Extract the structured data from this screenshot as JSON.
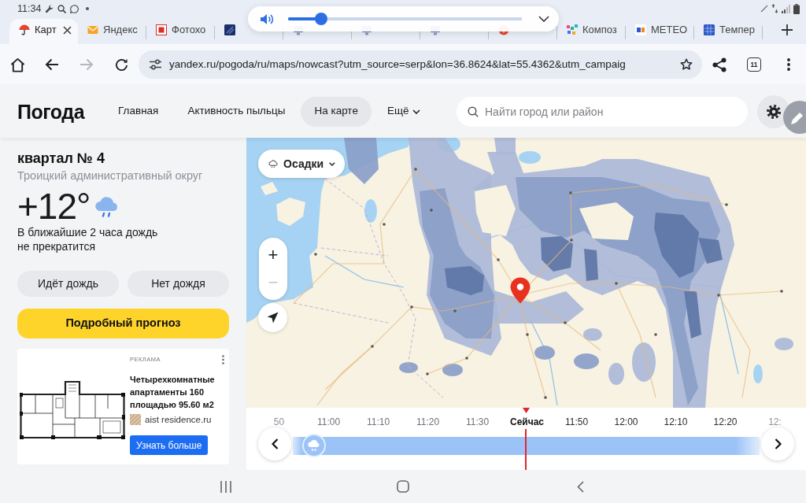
{
  "status_bar": {
    "time": "11:34"
  },
  "volume": {
    "level": 0.14
  },
  "tabs": [
    {
      "title": "Карт",
      "selected": true
    },
    {
      "title": "Яндекс",
      "selected": false
    },
    {
      "title": "Фотохо",
      "selected": false
    },
    {
      "selected": false
    },
    {
      "selected": false
    },
    {
      "selected": false
    },
    {
      "selected": false
    },
    {
      "selected": false
    },
    {
      "title": "Композ",
      "selected": false
    },
    {
      "title": "METEO",
      "selected": false
    },
    {
      "title": "Темпер",
      "selected": false
    }
  ],
  "toolbar": {
    "forward_disabled": true,
    "url": "yandex.ru/pogoda/ru/maps/nowcast?utm_source=serp&lon=36.8624&lat=55.4362&utm_campaig",
    "tab_count": "11"
  },
  "header": {
    "logo": "Погода",
    "nav": [
      {
        "label": "Главная",
        "selected": false,
        "kind": "link"
      },
      {
        "label": "Активность пыльцы",
        "selected": false,
        "kind": "link"
      },
      {
        "label": "На карте",
        "selected": true,
        "kind": "link"
      },
      {
        "label": "Ещё",
        "selected": false,
        "kind": "menu"
      }
    ],
    "search": {
      "placeholder": "Найти город или район"
    }
  },
  "location": {
    "title": "квартал № 4",
    "district": "Троицкий административный округ",
    "temperature": "+12°",
    "summary": "В ближайшие 2 часа дождь не прекратится",
    "actions": [
      "Идёт дождь",
      "Нет дождя"
    ],
    "forecast_button": "Подробный прогноз"
  },
  "ad": {
    "label": "РЕКЛАМА",
    "title": "Четырехкомнатные апартаменты 160 площадью 95.60 м2",
    "domain": "aist residence.ru",
    "button": "Узнать больше"
  },
  "map": {
    "layer": "Осадки",
    "zoom": [
      {
        "label": "+",
        "disabled": false
      },
      {
        "label": "−",
        "disabled": true
      }
    ]
  },
  "timeline": {
    "labels": [
      {
        "text": "50",
        "kind": "edge"
      },
      {
        "text": "11:00",
        "kind": "past"
      },
      {
        "text": "11:10",
        "kind": "past"
      },
      {
        "text": "11:20",
        "kind": "past"
      },
      {
        "text": "11:30",
        "kind": "past"
      },
      {
        "text": "Сейчас",
        "kind": "now"
      },
      {
        "text": "11:50",
        "kind": "future"
      },
      {
        "text": "12:00",
        "kind": "future"
      },
      {
        "text": "12:10",
        "kind": "future"
      },
      {
        "text": "12:20",
        "kind": "future"
      },
      {
        "text": "12:",
        "kind": "edge"
      }
    ],
    "level": 0.045
  }
}
